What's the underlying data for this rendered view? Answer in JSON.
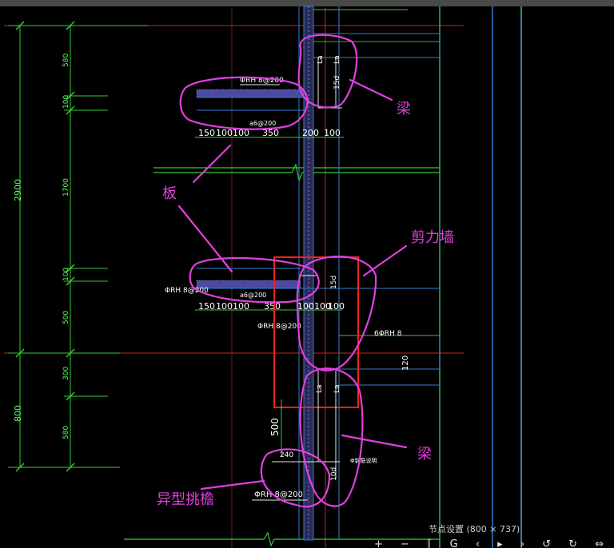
{
  "status_bar": {
    "caption": "节点设置 (800 × 737)"
  },
  "toolbar": {
    "glyphs": "+ − ⟦ G ‹ ▸ › ↺ ↻ ⇔ ⟂"
  },
  "colors": {
    "background": "#000000",
    "dimension": "#33cc33",
    "concrete_outline": "#2f7fd1",
    "rebar": "#e8e8e8",
    "axis": "#cc2222",
    "highlight_box": "#ff2020",
    "annotation": "#e040e0"
  },
  "left_dimensions": {
    "overall": [
      "2900",
      "800"
    ],
    "segments": [
      "580",
      "100",
      "1700",
      "100",
      "500",
      "300",
      "580"
    ]
  },
  "upper_slab": {
    "rebar_top": "ΦRH 8@200",
    "rebar_bottom": "a6@200",
    "dims": [
      "150",
      "100100",
      "350",
      "200",
      "100"
    ],
    "wall_labels": [
      "La",
      "La",
      "15d"
    ]
  },
  "lower_slab": {
    "rebar_left": "ΦRH 8@200",
    "rebar_mid": "a6@200",
    "rebar_below": "ΦRH 8@200",
    "dims": [
      "150",
      "100100",
      "350",
      "100100",
      "100"
    ],
    "wall_labels": [
      "15d"
    ],
    "side_note": "6ΦRH 8",
    "side_dim": "120"
  },
  "lower_beam": {
    "labels": [
      "La",
      "La"
    ],
    "dim_500": "500",
    "dim_240": "240",
    "anchor": "10d",
    "note": "Φ钢筋说明"
  },
  "canopy": {
    "rebar": "ΦRH 8@200"
  },
  "annotations": {
    "beam_top": "梁",
    "slab": "板",
    "shear_wall": "剪力墙",
    "beam_bottom": "梁",
    "canopy": "异型挑檐"
  }
}
